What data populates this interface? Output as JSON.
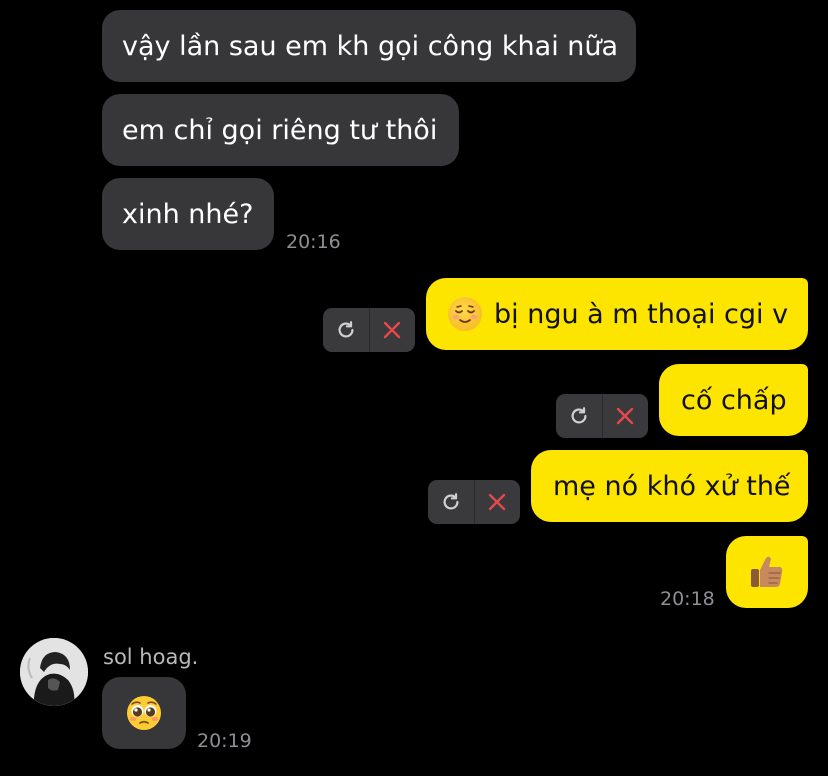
{
  "colors": {
    "background": "#000000",
    "incoming_bubble": "#373739",
    "outgoing_bubble": "#fee500",
    "timestamp": "#8e8e93",
    "failed_x": "#e5484d"
  },
  "incoming_block_1": {
    "messages": [
      "vậy lần sau em kh gọi công khai nữa",
      "em chỉ gọi riêng tư thôi",
      "xinh nhé?"
    ],
    "time": "20:16"
  },
  "outgoing_block": {
    "messages": [
      {
        "emoji": "relieved-face-icon",
        "text": "bị ngu à m thoại cgi v",
        "status": "failed"
      },
      {
        "text": "cố chấp",
        "status": "failed"
      },
      {
        "text": "mẹ nó khó xử thế",
        "status": "failed"
      },
      {
        "emoji": "thumbs-up-icon",
        "text": "",
        "status": "sent"
      }
    ],
    "time": "20:18"
  },
  "incoming_block_2": {
    "sender": "sol hoag.",
    "messages": [
      {
        "emoji": "pleading-face-icon"
      }
    ],
    "time": "20:19"
  },
  "icons": {
    "retry": "refresh-icon",
    "delete": "close-icon"
  }
}
